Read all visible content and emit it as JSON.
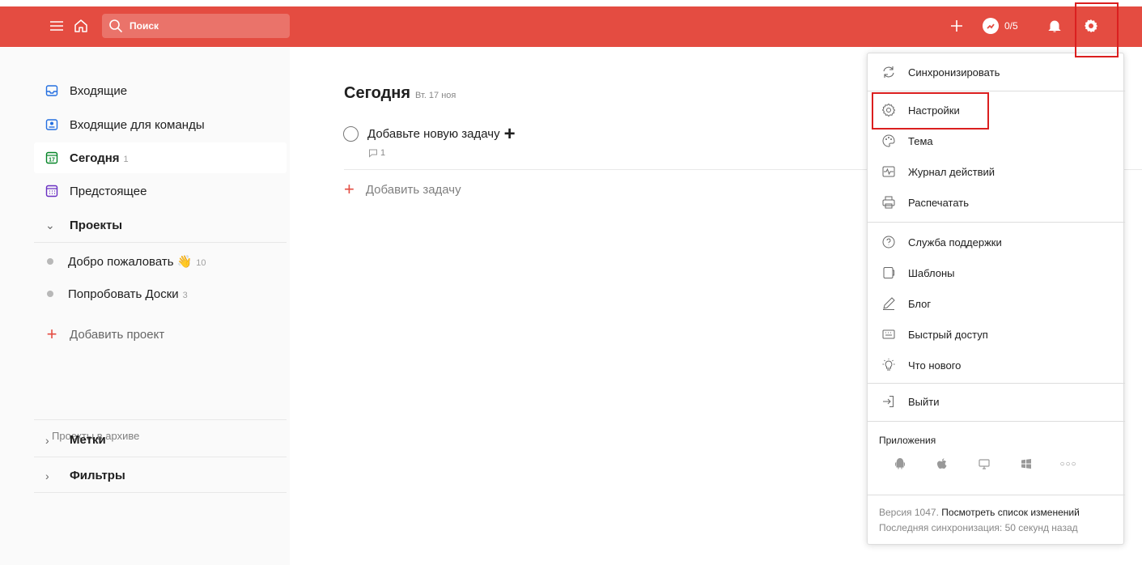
{
  "colors": {
    "accent": "#e44c41"
  },
  "topbar": {
    "search_placeholder": "Поиск",
    "karma_label": "0/5"
  },
  "sidebar": {
    "items": [
      {
        "label": "Входящие",
        "icon": "inbox-icon"
      },
      {
        "label": "Входящие для команды",
        "icon": "team-inbox-icon"
      },
      {
        "label": "Сегодня",
        "count": "1",
        "icon": "calendar-today-icon",
        "icon_text": "17"
      },
      {
        "label": "Предстоящее",
        "icon": "calendar-upcoming-icon"
      }
    ],
    "projects_header": "Проекты",
    "projects": [
      {
        "label": "Добро пожаловать",
        "emoji": "👋",
        "count": "10"
      },
      {
        "label": "Попробовать Доски",
        "count": "3"
      }
    ],
    "add_project": "Добавить проект",
    "archived": "Проекты в архиве",
    "labels_header": "Метки",
    "filters_header": "Фильтры"
  },
  "main": {
    "title": "Сегодня",
    "date": "Вт. 17 ноя",
    "tasks": [
      {
        "title": "Добавьте новую задачу",
        "comments": "1"
      }
    ],
    "add_task": "Добавить задачу"
  },
  "menu": {
    "sync": "Синхронизировать",
    "settings": "Настройки",
    "theme": "Тема",
    "activity": "Журнал действий",
    "print": "Распечатать",
    "support": "Служба поддержки",
    "templates": "Шаблоны",
    "blog": "Блог",
    "shortcuts": "Быстрый доступ",
    "whats_new": "Что нового",
    "logout": "Выйти",
    "apps_title": "Приложения",
    "apps": [
      "android-icon",
      "apple-icon",
      "desktop-icon",
      "windows-icon",
      "more-icon"
    ],
    "version_text": "Версия 1047.",
    "changelog_link": "Посмотреть список изменений",
    "last_sync": "Последняя синхронизация: 50 секунд назад"
  }
}
